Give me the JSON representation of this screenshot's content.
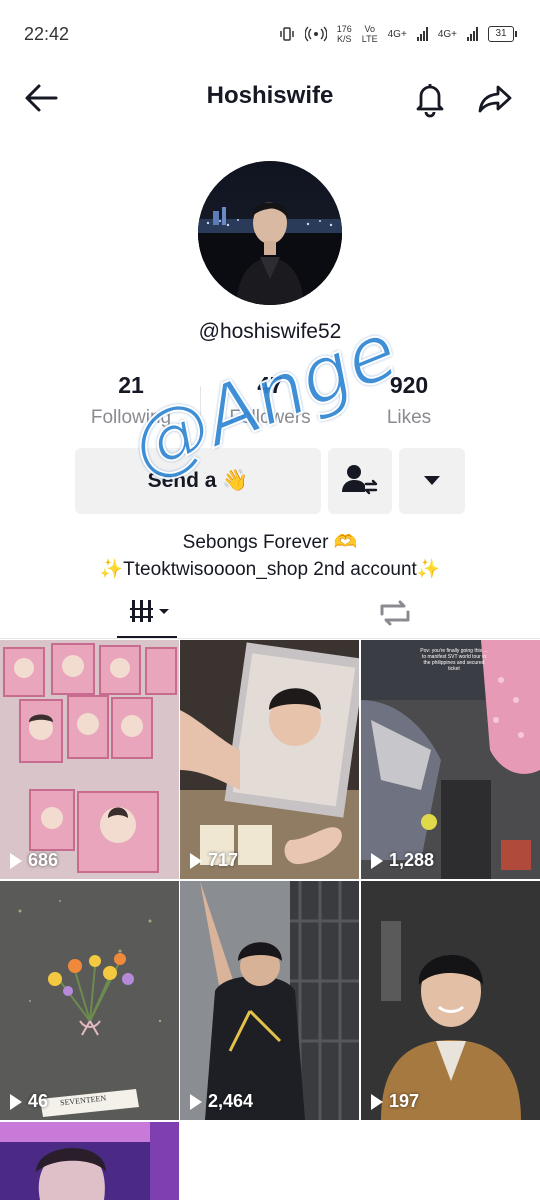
{
  "status_bar": {
    "time": "22:42",
    "speed_value": "176",
    "speed_unit": "K/S",
    "volte_top": "Vo",
    "volte_bottom": "LTE",
    "net1": "4G+",
    "net2": "4G+",
    "battery": "31"
  },
  "header": {
    "title": "Hoshiswife"
  },
  "profile": {
    "username": "@hoshiswife52",
    "stats": [
      {
        "value": "21",
        "label": "Following"
      },
      {
        "value": "47",
        "label": "Followers"
      },
      {
        "value": "920",
        "label": "Likes"
      }
    ],
    "message_button": "Send a 👋",
    "bio_line1": "Sebongs Forever 🫶",
    "bio_line2": "✨Tteoktwisoooon_shop 2nd account✨"
  },
  "watermark": "@Ange",
  "tabs": [
    {
      "icon": "videos-grid-icon",
      "active": true
    },
    {
      "icon": "repost-icon",
      "active": false
    }
  ],
  "videos": [
    {
      "views": "686"
    },
    {
      "views": "717"
    },
    {
      "views": "1,288"
    },
    {
      "views": "46"
    },
    {
      "views": "2,464"
    },
    {
      "views": "197"
    }
  ],
  "thumb_texts": {
    "tile3_caption": "Pov: you're finally going this ... to manifest SVT world tour in the philippines and secured ticket",
    "tile4_banner": "SEVENTEEN"
  },
  "colors": {
    "text": "#161823",
    "muted": "#8a8b91",
    "button_bg": "#f1f1f2",
    "watermark": "#2f86d4"
  }
}
